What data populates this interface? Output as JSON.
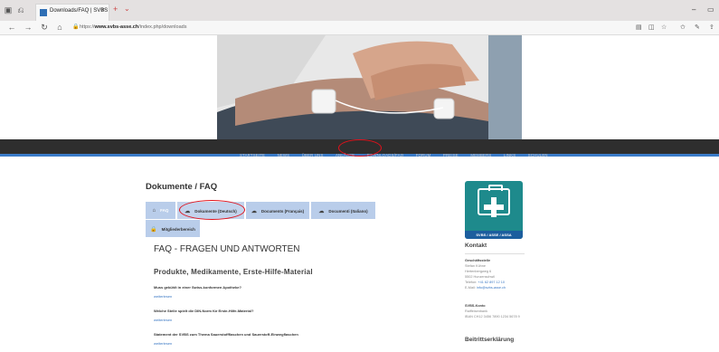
{
  "browser": {
    "tab_title": "Downloads/FAQ | SVBS",
    "tab_close": "×",
    "new_tab": "+",
    "url_scheme": "https://",
    "url_domain": "www.svbs-asse.ch",
    "url_path": "/index.php/downloads"
  },
  "nav": {
    "items": [
      "STARTSEITE",
      "NEWS",
      "ÜBER UNS",
      "ANLÄSSE",
      "DOWNLOADS/FAQ",
      "FORUM",
      "PREISE",
      "MEMBERS",
      "LINKS",
      "SCHULEN"
    ]
  },
  "page": {
    "title": "Dokumente / FAQ",
    "tabs": [
      {
        "label": "FAQ",
        "icon": "home-icon"
      },
      {
        "label": "Dokumente (Deutsch)",
        "icon": "cloud-download-icon"
      },
      {
        "label": "Documents (Français)",
        "icon": "cloud-download-icon"
      },
      {
        "label": "Documenti (Italiano)",
        "icon": "cloud-download-icon"
      },
      {
        "label": "Mitgliederbereich",
        "icon": "lock-icon"
      }
    ],
    "faq_title": "FAQ - FRAGEN UND ANTWORTEN",
    "faq_subtitle": "Produkte, Medikamente, Erste-Hilfe-Material",
    "questions": [
      {
        "q": "Muss gekühlt in einer Swiss-konformen Apotheke?",
        "a": "weiterlesen"
      },
      {
        "q": "Welche Stelle spielt die DIN-Norm für Erste-Hilfe-Material?",
        "a": "weiterlesen"
      },
      {
        "q": "Statement der SVBS zum Thema Sauerstoffflaschen und Sauerstoff-Einwegflaschen",
        "a": "weiterlesen"
      }
    ]
  },
  "sidebar": {
    "logo_text": "SVBS / ASSE / ASSA",
    "kontakt_heading": "Kontakt",
    "geschaeftsstelle_label": "Geschäftsstelle",
    "address_lines": [
      "Stefan Kühne",
      "Hertenbergweg 6",
      "5502 Hunzenschwil",
      "Telefon: ",
      "E-Mail: "
    ],
    "phone_link": "+41 62 897 12 10",
    "email_link": "info@svbs-asse.ch",
    "bank_label": "SVBS-Konto",
    "bank_lines": [
      "Raiffeisenbank",
      "IBAN CH12 3456 7890 1234 5678 9"
    ],
    "beitritt_heading": "Beitrittserklärung"
  }
}
